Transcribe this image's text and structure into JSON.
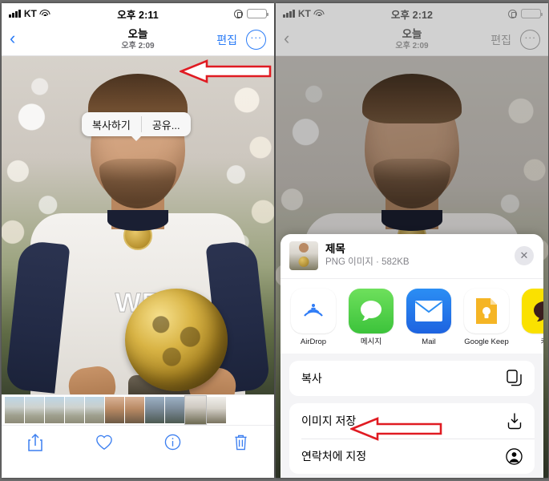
{
  "left_phone": {
    "status_bar": {
      "carrier": "KT",
      "time": "오후 2:11",
      "signal_icon": "signal-bars-icon",
      "wifi_icon": "wifi-icon",
      "lock_icon": "rotation-lock-icon",
      "battery_icon": "battery-charging-icon"
    },
    "nav_bar": {
      "back_icon": "chevron-left-icon",
      "title": "오늘",
      "subtitle": "오후 2:09",
      "edit_label": "편집",
      "more_label": "···"
    },
    "popup_menu": {
      "copy_label": "복사하기",
      "share_label": "공유..."
    },
    "toolbar": {
      "share_icon": "share-icon",
      "favorite_icon": "heart-icon",
      "info_icon": "info-icon",
      "delete_icon": "trash-icon"
    }
  },
  "right_phone": {
    "status_bar": {
      "carrier": "KT",
      "time": "오후 2:12",
      "signal_icon": "signal-bars-icon",
      "wifi_icon": "wifi-icon",
      "lock_icon": "rotation-lock-icon",
      "battery_icon": "battery-charging-icon"
    },
    "nav_bar": {
      "back_icon": "chevron-left-icon",
      "title": "오늘",
      "subtitle": "오후 2:09",
      "edit_label": "편집",
      "more_label": "···"
    },
    "share_sheet": {
      "item_title": "제목",
      "item_meta": "PNG 이미지 · 582KB",
      "close_icon": "close-icon",
      "apps": [
        {
          "label": "AirDrop",
          "icon": "airdrop-icon"
        },
        {
          "label": "메시지",
          "icon": "messages-icon"
        },
        {
          "label": "Mail",
          "icon": "mail-icon"
        },
        {
          "label": "Google Keep",
          "icon": "google-keep-icon"
        },
        {
          "label": "카",
          "icon": "kakaotalk-icon"
        }
      ],
      "actions": [
        {
          "label": "복사",
          "icon": "copy-icon"
        },
        {
          "label": "이미지 저장",
          "icon": "download-icon"
        },
        {
          "label": "연락처에 지정",
          "icon": "person-circle-icon"
        }
      ]
    }
  },
  "annotations": {
    "arrow_color": "#e01b22",
    "arrow_fill": "#ffffff",
    "left_arrow_target": "공유...",
    "right_arrow_target": "이미지 저장"
  }
}
